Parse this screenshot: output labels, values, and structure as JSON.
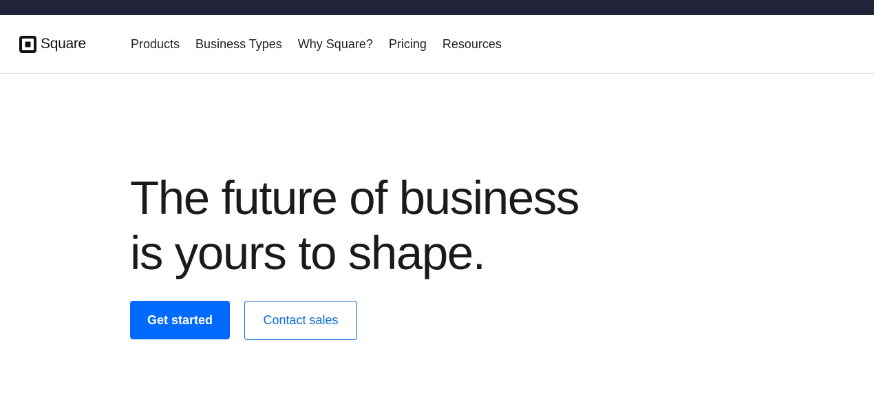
{
  "brand": {
    "name": "Square",
    "logo_icon": "square-logo-icon",
    "top_strip_color": "#212338"
  },
  "nav": {
    "items": [
      {
        "label": "Products"
      },
      {
        "label": "Business Types"
      },
      {
        "label": "Why Square?"
      },
      {
        "label": "Pricing"
      },
      {
        "label": "Resources"
      }
    ]
  },
  "hero": {
    "title_line1": "The future of business",
    "title_line2": "is yours to shape.",
    "primary_cta": "Get started",
    "secondary_cta": "Contact sales"
  },
  "colors": {
    "accent": "#006aff",
    "secondary_outline": "#0b6bd6",
    "text": "#1a1a1a"
  }
}
